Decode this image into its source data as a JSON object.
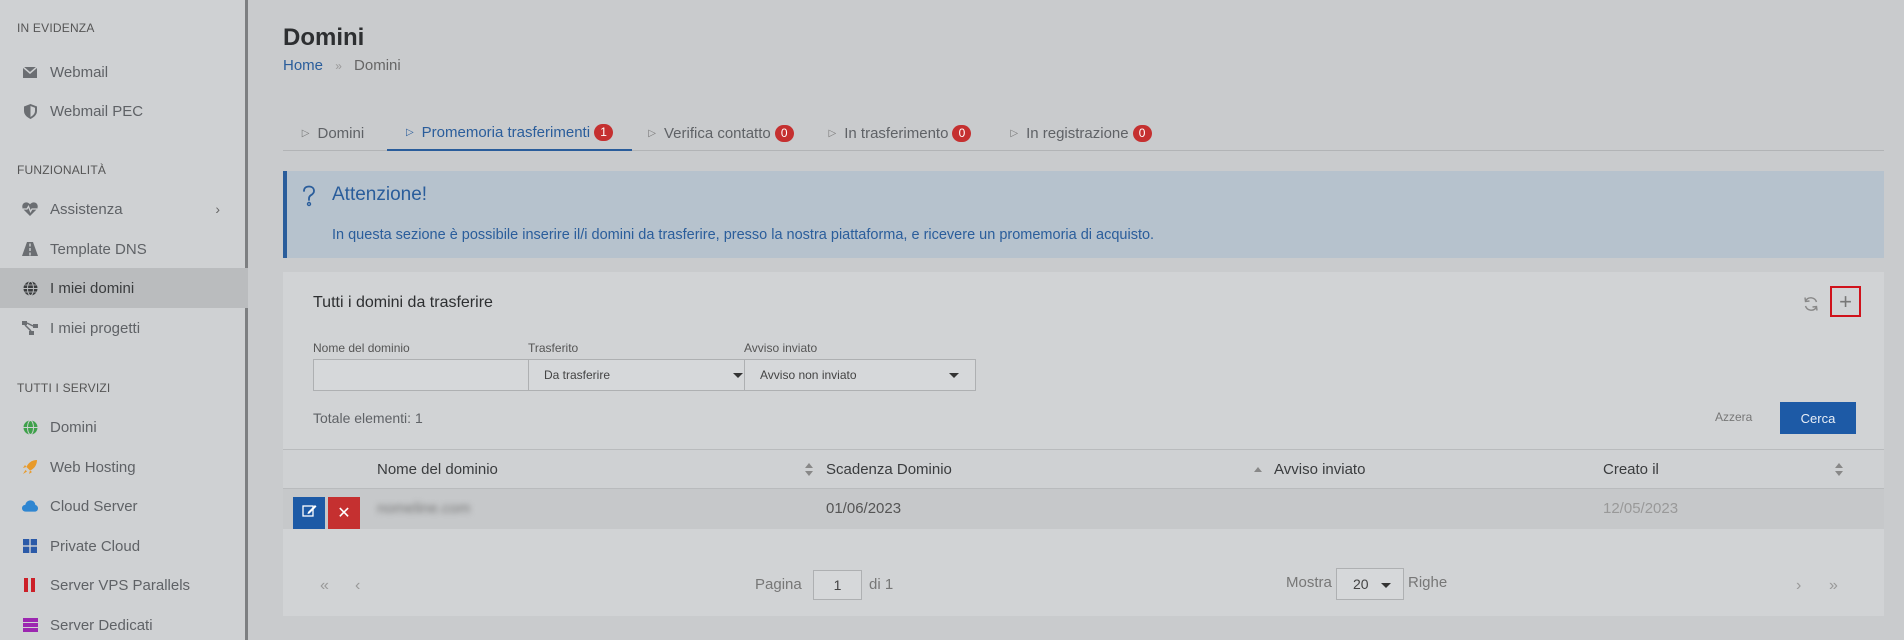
{
  "sidebar": {
    "sections": {
      "highlight": "IN EVIDENZA",
      "features": "FUNZIONALITÀ",
      "services": "TUTTI I SERVIZI"
    },
    "items": {
      "webmail": "Webmail",
      "webmail_pec": "Webmail PEC",
      "assistenza": "Assistenza",
      "template_dns": "Template DNS",
      "miei_domini": "I miei domini",
      "miei_progetti": "I miei progetti",
      "domini": "Domini",
      "web_hosting": "Web Hosting",
      "cloud_server": "Cloud Server",
      "private_cloud": "Private Cloud",
      "server_vps": "Server VPS Parallels",
      "server_dedicati": "Server Dedicati"
    }
  },
  "header": {
    "title": "Domini",
    "breadcrumb": {
      "home": "Home",
      "separator": "»",
      "current": "Domini"
    }
  },
  "tabs": {
    "domini": {
      "label": "Domini"
    },
    "promemoria": {
      "label": "Promemoria trasferimenti",
      "count": "1"
    },
    "verifica": {
      "label": "Verifica contatto",
      "count": "0"
    },
    "trasferimento": {
      "label": "In trasferimento",
      "count": "0"
    },
    "registrazione": {
      "label": "In registrazione",
      "count": "0"
    }
  },
  "alert": {
    "title": "Attenzione!",
    "text": "In questa sezione è possibile inserire il/i domini da trasferire, presso la nostra piattaforma, e ricevere un promemoria di acquisto."
  },
  "panel": {
    "title": "Tutti i domini da trasferire",
    "add_label": "+",
    "filters": {
      "domain_label": "Nome del dominio",
      "domain_value": "",
      "transferred_label": "Trasferito",
      "transferred_value": "Da trasferire",
      "notice_label": "Avviso inviato",
      "notice_value": "Avviso non inviato"
    },
    "total": "Totale elementi: 1",
    "reset_label": "Azzera",
    "search_label": "Cerca"
  },
  "table": {
    "columns": {
      "domain": "Nome del dominio",
      "expiry": "Scadenza Dominio",
      "notice": "Avviso inviato",
      "created": "Creato il"
    },
    "rows": [
      {
        "domain": "nomeline.com",
        "expiry": "01/06/2023",
        "notice": "",
        "created": "12/05/2023"
      }
    ]
  },
  "pagination": {
    "first": "«",
    "prev": "‹",
    "next": "›",
    "last": "»",
    "page_label": "Pagina",
    "page_value": "1",
    "of_label": "di 1",
    "show_label": "Mostra",
    "rows_value": "20",
    "rows_label": "Righe"
  },
  "colors": {
    "accent": "#2a5d9b",
    "primary_button": "#1d5aa6",
    "danger": "#c53030",
    "highlight_border": "#d0121b"
  }
}
